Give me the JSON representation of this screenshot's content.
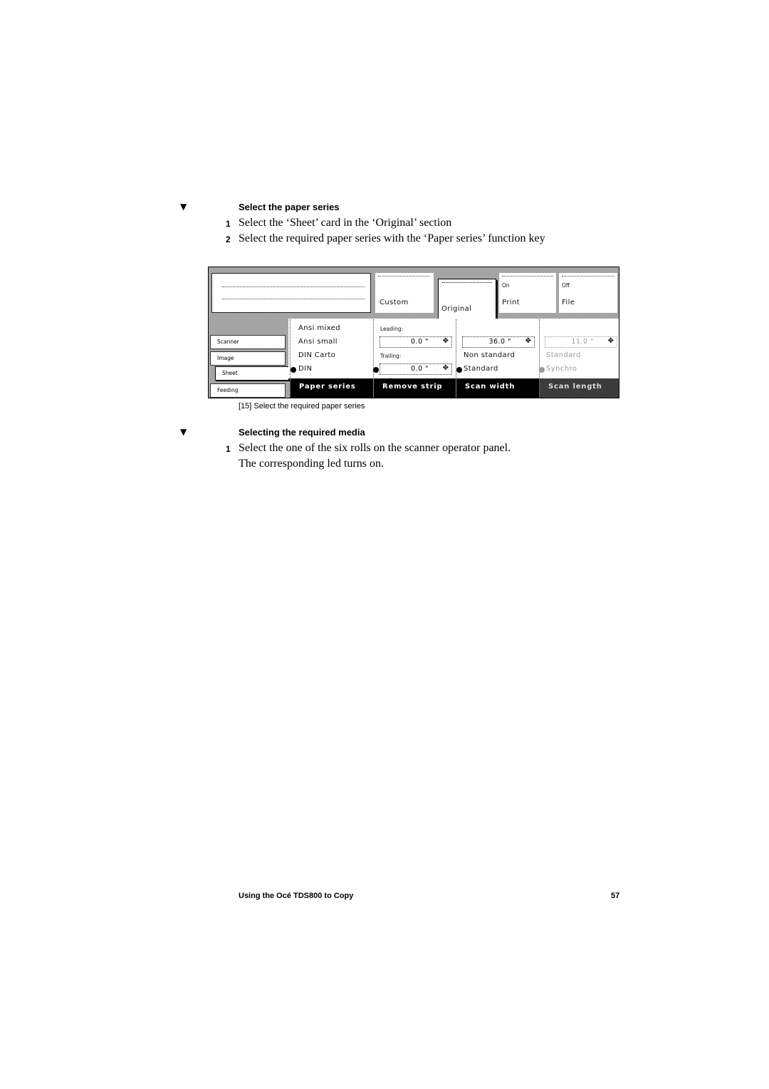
{
  "section1": {
    "marker_icon": "down-triangle",
    "heading": "Select the paper series",
    "steps": [
      {
        "num": "1",
        "text": "Select the ‘Sheet’ card in the ‘Original’ section"
      },
      {
        "num": "2",
        "text": "Select the required paper series with the ‘Paper series’ function key"
      }
    ]
  },
  "panel": {
    "top_cards": {
      "custom": {
        "label": "Custom"
      },
      "original": {
        "label": "Original",
        "selected": true
      },
      "print": {
        "status": "On",
        "label": "Print"
      },
      "file": {
        "status": "Off",
        "label": "File"
      }
    },
    "tabs": [
      {
        "label": "Scanner"
      },
      {
        "label": "Image"
      },
      {
        "label": "Sheet",
        "selected": true
      },
      {
        "label": "Feeding"
      }
    ],
    "paper_series": {
      "options": [
        "Ansi mixed",
        "Ansi small",
        "DIN Carto",
        "DIN"
      ],
      "selected": "DIN",
      "key_label": "Paper series"
    },
    "remove_strip": {
      "leading_label": "Leading:",
      "leading_value": "0.0 \"",
      "trailing_label": "Trailing:",
      "trailing_value": "0.0 \"",
      "key_label": "Remove strip"
    },
    "scan_width": {
      "value": "36.0 \"",
      "options": [
        "Non standard",
        "Standard"
      ],
      "selected": "Standard",
      "key_label": "Scan width"
    },
    "scan_length": {
      "value": "11.0 \"",
      "options": [
        "Standard",
        "Synchro"
      ],
      "selected": "Synchro",
      "disabled": true,
      "key_label": "Scan length"
    }
  },
  "caption": "[15] Select the required paper series",
  "section2": {
    "marker_icon": "down-triangle",
    "heading": "Selecting the required media",
    "steps": [
      {
        "num": "1",
        "text": "Select the one of the six rolls on the scanner operator panel.",
        "continuation": "The corresponding led turns on."
      }
    ]
  },
  "footer": {
    "title": "Using the Océ TDS800 to Copy",
    "page": "57"
  }
}
